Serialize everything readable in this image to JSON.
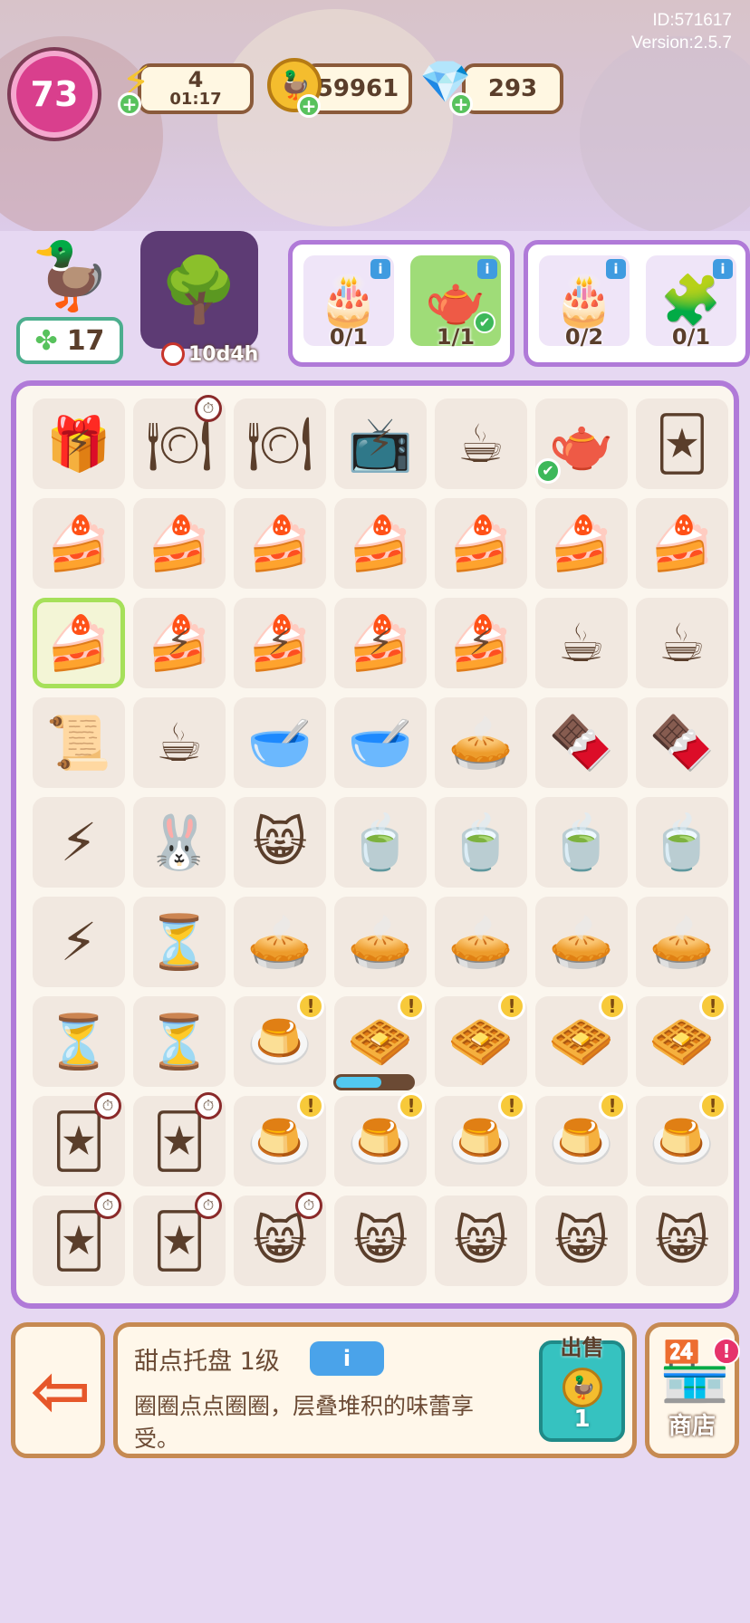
{
  "header": {
    "id_text": "ID:571617",
    "version_text": "Version:2.5.7",
    "level": "73",
    "energy": {
      "value": "4",
      "timer": "01:17"
    },
    "coins": "59961",
    "gems": "293"
  },
  "builder": {
    "count": "17"
  },
  "event": {
    "timer": "10d4h"
  },
  "orders": [
    {
      "items": [
        {
          "count": "0/1",
          "icon": "🎂"
        },
        {
          "count": "1/1",
          "icon": "🫖",
          "done": true
        }
      ]
    },
    {
      "items": [
        {
          "count": "0/2",
          "icon": "🎂"
        },
        {
          "count": "0/1",
          "icon": "🧩"
        }
      ]
    }
  ],
  "board": {
    "rows": [
      [
        "🎁",
        "🍽",
        "🍽",
        "📺",
        "☕",
        "🫖",
        "🃏"
      ],
      [
        "🍰",
        "🍰",
        "🍰",
        "🍰",
        "🍰",
        "🍰",
        "🍰"
      ],
      [
        "🍰",
        "🍰",
        "🍰",
        "🍰",
        "🍰",
        "☕",
        "☕"
      ],
      [
        "📜",
        "☕",
        "🥣",
        "🥣",
        "🥧",
        "🍫",
        "🍫"
      ],
      [
        "⚡",
        "🐰",
        "😸",
        "🍵",
        "🍵",
        "🍵",
        "🍵"
      ],
      [
        "⚡",
        "⏳",
        "🥧",
        "🥧",
        "🥧",
        "🥧",
        "🥧"
      ],
      [
        "⏳",
        "⏳",
        "🍮",
        "🧇",
        "🧇",
        "🧇",
        "🧇"
      ],
      [
        "🃏",
        "🃏",
        "🍮",
        "🍮",
        "🍮",
        "🍮",
        "🍮"
      ],
      [
        "🃏",
        "🃏",
        "😸",
        "😸",
        "😸",
        "😸",
        "😸"
      ]
    ],
    "progress_fraction": 0.6
  },
  "info": {
    "title": "甜点托盘 1级",
    "info_button": "i",
    "description": "圈圈点点圈圈，层叠堆积的味蕾享受。",
    "sell_label": "出售",
    "sell_price": "1"
  },
  "shop": {
    "label": "商店"
  }
}
